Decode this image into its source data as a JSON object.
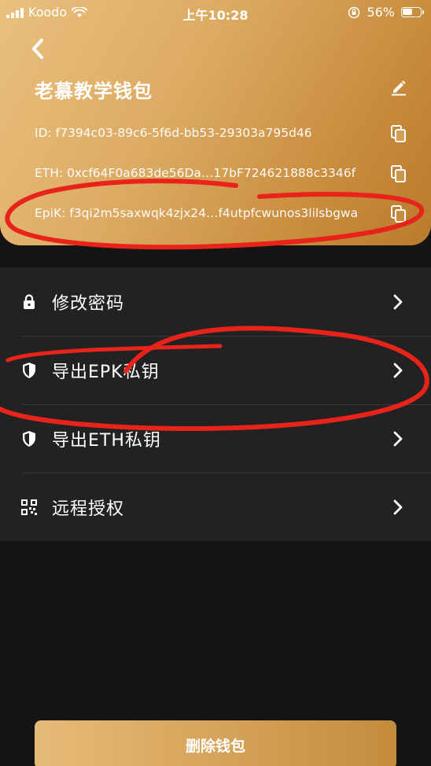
{
  "status_bar": {
    "carrier": "Koodo",
    "time": "上午10:28",
    "battery_percent": "56%",
    "battery_level": 0.56
  },
  "header": {
    "wallet_name": "老慕教学钱包",
    "id_line": "ID: f7394c03-89c6-5f6d-bb53-29303a795d46",
    "eth_line": "ETH: 0xcf64F0a683de56Da…17bF724621888c3346f",
    "epik_line": "EpiK: f3qi2m5saxwqk4zjx24…f4utpfcwunos3lilsbgwa"
  },
  "menu": {
    "items": [
      {
        "label": "修改密码",
        "icon": "lock-icon"
      },
      {
        "label": "导出EPK私钥",
        "icon": "shield-icon"
      },
      {
        "label": "导出ETH私钥",
        "icon": "shield-icon"
      },
      {
        "label": "远程授权",
        "icon": "qr-code-icon"
      }
    ]
  },
  "footer": {
    "delete_label": "删除钱包"
  },
  "colors": {
    "gold_light": "#e9c07d",
    "gold_dark": "#b97a2c",
    "background": "#141414",
    "menu_bg": "#222222",
    "annotation_red": "#e8231a"
  }
}
